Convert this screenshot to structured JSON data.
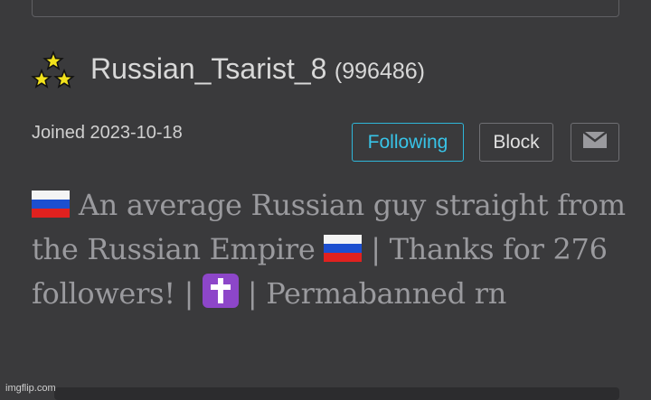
{
  "profile": {
    "username": "Russian_Tsarist_8",
    "user_id": "(996486)",
    "joined": "Joined 2023-10-18",
    "avatar_icon": "three-stars-icon"
  },
  "actions": {
    "following_label": "Following",
    "block_label": "Block",
    "message_icon": "envelope-icon"
  },
  "bio": {
    "part1": " An average Russian guy straight from the Russian Empire ",
    "part2": " | Thanks for 276 followers! | ",
    "part3": " | Permabanned rn"
  },
  "watermark": "imgflip.com",
  "colors": {
    "background": "#3a3a3c",
    "accent": "#38c4e8",
    "bio_text": "#9a9a9e"
  }
}
